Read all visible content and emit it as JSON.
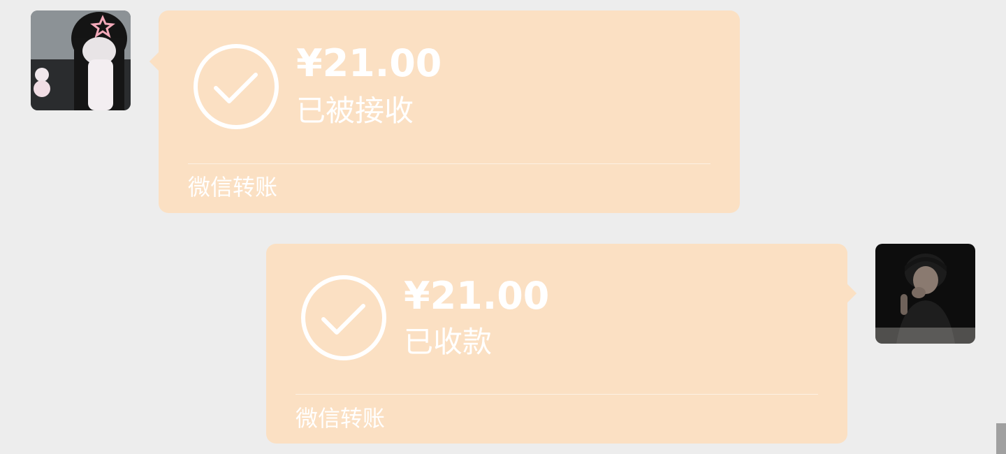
{
  "messages": [
    {
      "side": "left",
      "avatar": "avatar-girl",
      "amount": "¥21.00",
      "status": "已被接收",
      "footer": "微信转账"
    },
    {
      "side": "right",
      "avatar": "avatar-boy",
      "amount": "¥21.00",
      "status": "已收款",
      "footer": "微信转账"
    }
  ],
  "colors": {
    "background": "#ededed",
    "bubble": "#fbe0c3",
    "text": "#ffffff"
  },
  "icons": {
    "status": "check-circle-icon"
  }
}
